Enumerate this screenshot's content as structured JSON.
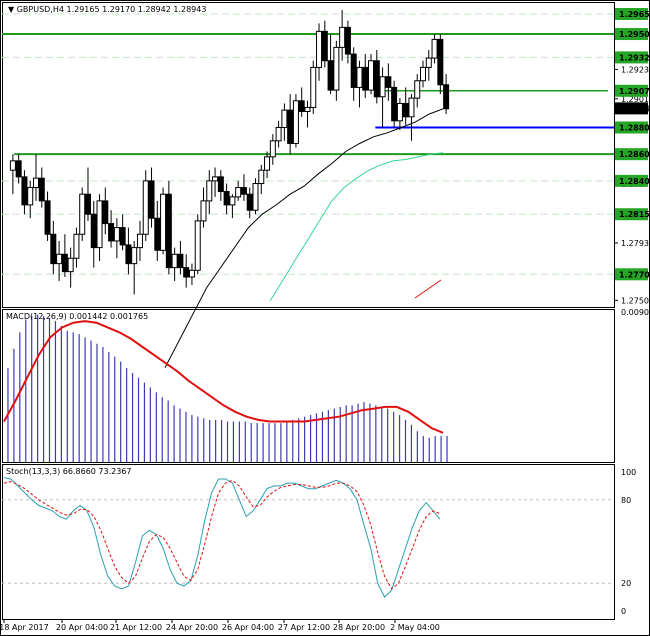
{
  "window": {
    "symbol_header": "GBPUSD,H4",
    "ohlc": "1.29165 1.29170 1.28942 1.28943"
  },
  "colors": {
    "candle": "#000000",
    "grid": "#c7e5c7",
    "level_green": "#1f9a1f",
    "level_blue": "#0000ff",
    "ma_slow": "#000000",
    "ma_fast": "#37d494",
    "macd_hist": "#3b3bb5",
    "macd_signal": "#e01010",
    "stoch_main": "#2aa0b0",
    "stoch_signal": "#e01010",
    "price_tag_green": "#26a626",
    "price_tag_black": "#000000"
  },
  "chart_data": [
    {
      "type": "candlestick",
      "title": "GBPUSD,H4",
      "ylim": [
        1.27455,
        1.2974
      ],
      "y_ticks": [
        "1.27505",
        "1.27935",
        "1.28375",
        "1.28815",
        "1.29015",
        "1.29235"
      ],
      "price_tags": [
        {
          "label": "1.29650",
          "value": 1.2965,
          "style": "green"
        },
        {
          "label": "1.29500",
          "value": 1.295,
          "style": "green"
        },
        {
          "label": "1.29325",
          "value": 1.29325,
          "style": "green"
        },
        {
          "label": "1.29075",
          "value": 1.29075,
          "style": "green"
        },
        {
          "label": "1.28943",
          "value": 1.28943,
          "style": "black"
        },
        {
          "label": "1.28800",
          "value": 1.288,
          "style": "green"
        },
        {
          "label": "1.28600",
          "value": 1.286,
          "style": "green"
        },
        {
          "label": "1.28400",
          "value": 1.284,
          "style": "green"
        },
        {
          "label": "1.28150",
          "value": 1.2815,
          "style": "green"
        },
        {
          "label": "1.27700",
          "value": 1.277,
          "style": "green"
        }
      ],
      "levels": [
        {
          "value": 1.295,
          "from": 0,
          "to": 1,
          "color": "green",
          "width": 2
        },
        {
          "value": 1.29075,
          "from": 0.61,
          "to": 0.99,
          "color": "green",
          "width": 1.5
        },
        {
          "value": 1.288,
          "from": 0.61,
          "to": 1,
          "color": "blue",
          "width": 2
        },
        {
          "value": 1.286,
          "from": 0.02,
          "to": 1,
          "color": "green",
          "width": 2
        }
      ],
      "dashed_levels": [
        1.2965,
        1.29325,
        1.284,
        1.2815,
        1.277
      ],
      "x_ticks": [
        "18 Apr 2017",
        "20 Apr 04:00",
        "21 Apr 12:00",
        "24 Apr 20:00",
        "26 Apr 04:00",
        "27 Apr 12:00",
        "28 Apr 20:00",
        "2 May 04:00"
      ],
      "candles": [
        [
          1.2848,
          1.286,
          1.283,
          1.2855
        ],
        [
          1.2855,
          1.286,
          1.2838,
          1.2843
        ],
        [
          1.2843,
          1.2848,
          1.2815,
          1.2822
        ],
        [
          1.2822,
          1.284,
          1.2812,
          1.2835
        ],
        [
          1.2835,
          1.286,
          1.2825,
          1.2842
        ],
        [
          1.2842,
          1.285,
          1.282,
          1.2825
        ],
        [
          1.2825,
          1.2832,
          1.2795,
          1.28
        ],
        [
          1.28,
          1.281,
          1.277,
          1.2778
        ],
        [
          1.2778,
          1.2795,
          1.2765,
          1.2785
        ],
        [
          1.2785,
          1.28,
          1.2768,
          1.2772
        ],
        [
          1.2772,
          1.279,
          1.276,
          1.2782
        ],
        [
          1.2782,
          1.2805,
          1.2775,
          1.28
        ],
        [
          1.28,
          1.2835,
          1.2795,
          1.283
        ],
        [
          1.283,
          1.285,
          1.281,
          1.2815
        ],
        [
          1.2815,
          1.2825,
          1.2775,
          1.279
        ],
        [
          1.279,
          1.283,
          1.278,
          1.2825
        ],
        [
          1.2825,
          1.2835,
          1.28,
          1.2808
        ],
        [
          1.2808,
          1.2818,
          1.279,
          1.2795
        ],
        [
          1.2795,
          1.2812,
          1.2782,
          1.2805
        ],
        [
          1.2805,
          1.2815,
          1.2788,
          1.2792
        ],
        [
          1.2792,
          1.2805,
          1.277,
          1.2778
        ],
        [
          1.2778,
          1.2795,
          1.2755,
          1.279
        ],
        [
          1.279,
          1.281,
          1.278,
          1.28
        ],
        [
          1.28,
          1.2848,
          1.2795,
          1.284
        ],
        [
          1.284,
          1.285,
          1.2805,
          1.2812
        ],
        [
          1.2812,
          1.2825,
          1.278,
          1.2788
        ],
        [
          1.2788,
          1.2835,
          1.2785,
          1.283
        ],
        [
          1.283,
          1.284,
          1.277,
          1.2775
        ],
        [
          1.2775,
          1.279,
          1.2765,
          1.2785
        ],
        [
          1.2785,
          1.2795,
          1.277,
          1.2775
        ],
        [
          1.2775,
          1.2785,
          1.276,
          1.2768
        ],
        [
          1.2768,
          1.2778,
          1.2762,
          1.2773
        ],
        [
          1.2773,
          1.2815,
          1.277,
          1.281
        ],
        [
          1.281,
          1.2835,
          1.2805,
          1.2825
        ],
        [
          1.2825,
          1.2848,
          1.2815,
          1.284
        ],
        [
          1.284,
          1.285,
          1.2828,
          1.2843
        ],
        [
          1.2843,
          1.2848,
          1.2825,
          1.2832
        ],
        [
          1.2832,
          1.2838,
          1.2815,
          1.2822
        ],
        [
          1.2822,
          1.283,
          1.2812,
          1.2828
        ],
        [
          1.2828,
          1.284,
          1.2825,
          1.2835
        ],
        [
          1.2835,
          1.2845,
          1.2825,
          1.283
        ],
        [
          1.283,
          1.2835,
          1.2812,
          1.2818
        ],
        [
          1.2818,
          1.2842,
          1.2815,
          1.2838
        ],
        [
          1.2838,
          1.2852,
          1.283,
          1.2848
        ],
        [
          1.2848,
          1.2862,
          1.2842,
          1.2858
        ],
        [
          1.2858,
          1.2875,
          1.2852,
          1.287
        ],
        [
          1.287,
          1.2885,
          1.2865,
          1.288
        ],
        [
          1.288,
          1.2898,
          1.287,
          1.2893
        ],
        [
          1.2893,
          1.2905,
          1.286,
          1.2868
        ],
        [
          1.2868,
          1.2905,
          1.2865,
          1.29
        ],
        [
          1.29,
          1.291,
          1.2888,
          1.2892
        ],
        [
          1.2892,
          1.29,
          1.288,
          1.2895
        ],
        [
          1.2895,
          1.293,
          1.289,
          1.2925
        ],
        [
          1.2925,
          1.2958,
          1.2915,
          1.2952
        ],
        [
          1.2952,
          1.296,
          1.2925,
          1.293
        ],
        [
          1.293,
          1.295,
          1.2905,
          1.2908
        ],
        [
          1.2908,
          1.2945,
          1.29,
          1.294
        ],
        [
          1.294,
          1.2968,
          1.293,
          1.2955
        ],
        [
          1.2955,
          1.296,
          1.2928,
          1.2935
        ],
        [
          1.2935,
          1.294,
          1.29,
          1.291
        ],
        [
          1.291,
          1.293,
          1.2895,
          1.2925
        ],
        [
          1.2925,
          1.2935,
          1.2902,
          1.2908
        ],
        [
          1.2908,
          1.2935,
          1.2905,
          1.293
        ],
        [
          1.293,
          1.2938,
          1.2898,
          1.2903
        ],
        [
          1.2903,
          1.2925,
          1.288,
          1.2918
        ],
        [
          1.2918,
          1.2928,
          1.29,
          1.291
        ],
        [
          1.291,
          1.2915,
          1.288,
          1.2885
        ],
        [
          1.2885,
          1.2902,
          1.2878,
          1.2898
        ],
        [
          1.2898,
          1.291,
          1.2882,
          1.2888
        ],
        [
          1.2888,
          1.2905,
          1.287,
          1.2902
        ],
        [
          1.2902,
          1.292,
          1.2895,
          1.2915
        ],
        [
          1.2915,
          1.293,
          1.291,
          1.2925
        ],
        [
          1.2925,
          1.2938,
          1.2915,
          1.2932
        ],
        [
          1.2932,
          1.295,
          1.2928,
          1.2946
        ],
        [
          1.2946,
          1.295,
          1.2905,
          1.2912
        ],
        [
          1.2912,
          1.292,
          1.289,
          1.2894
        ]
      ],
      "ma_slow": [
        1.27,
        1.272,
        1.274,
        1.276,
        1.2775,
        1.279,
        1.2805,
        1.2815,
        1.2822,
        1.283,
        1.2836,
        1.2845,
        1.2853,
        1.2862,
        1.2868,
        1.2873,
        1.2876,
        1.288,
        1.2884,
        1.289,
        1.2894
      ],
      "ma_fast": [
        1.275,
        1.2765,
        1.278,
        1.2795,
        1.281,
        1.2825,
        1.2835,
        1.2842,
        1.2848,
        1.2852,
        1.2855,
        1.2856,
        1.2858,
        1.286,
        1.2861
      ]
    },
    {
      "type": "bar",
      "title": "MACD(12,26,9) 0.001442 0.001765",
      "y_tick": "0.009039",
      "ylim": [
        0,
        0.0092
      ],
      "histogram": [
        0.0058,
        0.007,
        0.008,
        0.0088,
        0.009,
        0.0091,
        0.009,
        0.0089,
        0.0087,
        0.0084,
        0.0081,
        0.008,
        0.0079,
        0.0077,
        0.0075,
        0.0073,
        0.0071,
        0.0068,
        0.0065,
        0.0062,
        0.0058,
        0.0055,
        0.0052,
        0.0049,
        0.0046,
        0.0043,
        0.004,
        0.0038,
        0.0035,
        0.0033,
        0.0031,
        0.0029,
        0.0028,
        0.0027,
        0.0026,
        0.0026,
        0.0026,
        0.0025,
        0.0025,
        0.0025,
        0.0025,
        0.0024,
        0.0024,
        0.0024,
        0.0024,
        0.0024,
        0.0024,
        0.0025,
        0.0026,
        0.0027,
        0.0028,
        0.0029,
        0.003,
        0.0031,
        0.0032,
        0.0033,
        0.0034,
        0.0035,
        0.0035,
        0.0036,
        0.0037,
        0.0036,
        0.0035,
        0.0034,
        0.0033,
        0.0031,
        0.0029,
        0.0026,
        0.0023,
        0.0019,
        0.0016,
        0.0015,
        0.0016,
        0.0016,
        0.0016
      ],
      "signal": [
        0.0025,
        0.0038,
        0.0052,
        0.0066,
        0.0077,
        0.0083,
        0.0086,
        0.0087,
        0.0086,
        0.0083,
        0.008,
        0.0076,
        0.0071,
        0.0066,
        0.0061,
        0.0056,
        0.005,
        0.0045,
        0.004,
        0.0035,
        0.0031,
        0.0028,
        0.0026,
        0.0025,
        0.0025,
        0.0025,
        0.0025,
        0.0026,
        0.0027,
        0.0028,
        0.003,
        0.0032,
        0.0033,
        0.0034,
        0.0034,
        0.0031,
        0.0026,
        0.0021,
        0.0018
      ],
      "series": [
        {
          "name": "MACD",
          "color": "blue"
        },
        {
          "name": "Signal",
          "color": "red"
        }
      ]
    },
    {
      "type": "line",
      "title": "Stoch(13,3,3) 66.8660 73.2367",
      "ylim": [
        0,
        100
      ],
      "y_ticks": [
        "100",
        "80",
        "20",
        "0"
      ],
      "levels": [
        80,
        20
      ],
      "main": [
        96,
        95,
        90,
        85,
        80,
        76,
        74,
        72,
        68,
        66,
        72,
        76,
        72,
        60,
        40,
        25,
        18,
        16,
        18,
        35,
        54,
        58,
        55,
        45,
        30,
        20,
        18,
        22,
        40,
        65,
        85,
        95,
        95,
        92,
        80,
        68,
        72,
        80,
        88,
        90,
        90,
        92,
        92,
        90,
        88,
        88,
        90,
        92,
        94,
        92,
        88,
        80,
        62,
        45,
        20,
        10,
        15,
        30,
        45,
        60,
        72,
        78,
        72,
        66
      ],
      "signal": [
        92,
        93,
        91,
        88,
        84,
        80,
        77,
        74,
        71,
        69,
        70,
        73,
        73,
        68,
        58,
        45,
        32,
        24,
        20,
        25,
        38,
        50,
        55,
        53,
        45,
        35,
        25,
        22,
        30,
        48,
        68,
        85,
        92,
        94,
        90,
        82,
        75,
        76,
        82,
        86,
        89,
        90,
        91,
        91,
        90,
        89,
        89,
        90,
        92,
        92,
        90,
        86,
        76,
        62,
        42,
        25,
        16,
        20,
        32,
        45,
        58,
        68,
        72,
        70
      ]
    }
  ]
}
